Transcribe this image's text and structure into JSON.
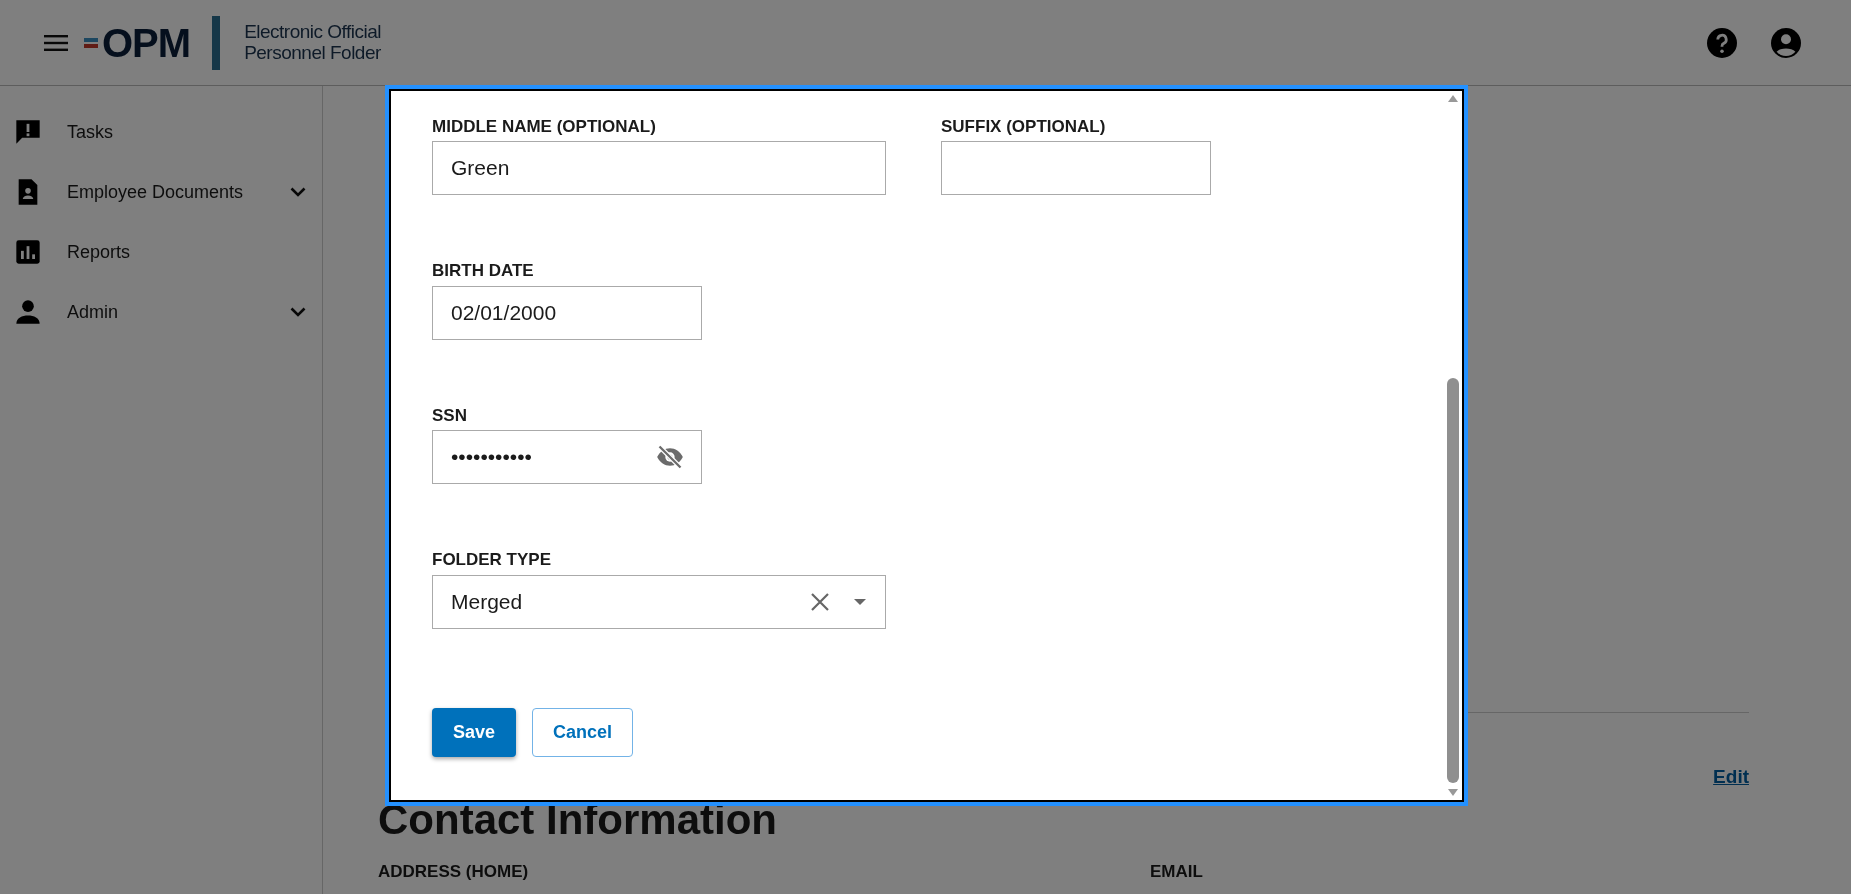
{
  "header": {
    "logo_text": "OPM",
    "app_title_lines": [
      "Electronic Official",
      "Personnel Folder"
    ]
  },
  "sidebar": {
    "items": [
      {
        "label": "Tasks",
        "expandable": false
      },
      {
        "label": "Employee Documents",
        "expandable": true
      },
      {
        "label": "Reports",
        "expandable": false
      },
      {
        "label": "Admin",
        "expandable": true
      }
    ]
  },
  "page": {
    "section_heading": "Contact Information",
    "edit_link": "Edit",
    "field_labels": [
      "ADDRESS (HOME)",
      "EMAIL"
    ]
  },
  "modal": {
    "rows": [
      {
        "fields": [
          {
            "kind": "text",
            "label": "MIDDLE NAME (OPTIONAL)",
            "value": "Green"
          },
          {
            "kind": "text",
            "label": "SUFFIX (OPTIONAL)"
          }
        ]
      },
      {
        "fields": [
          {
            "kind": "text",
            "label": "BIRTH DATE",
            "value": "02/01/2000"
          }
        ]
      },
      {
        "fields": [
          {
            "kind": "password",
            "label": "SSN",
            "value": "•••••••••••"
          }
        ]
      },
      {
        "fields": [
          {
            "kind": "select",
            "label": "FOLDER TYPE",
            "value": "Merged"
          }
        ]
      }
    ],
    "buttons": [
      {
        "label": "Save",
        "kind": "primary"
      },
      {
        "label": "Cancel",
        "kind": "outline"
      }
    ]
  }
}
